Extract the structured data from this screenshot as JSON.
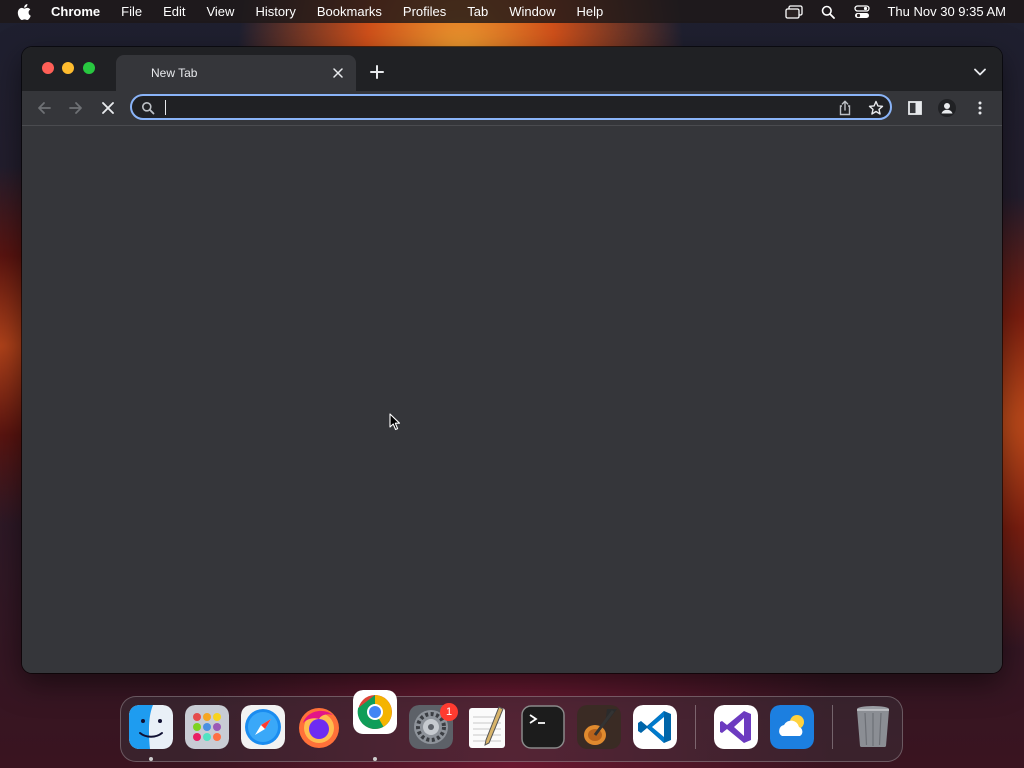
{
  "menubar": {
    "app_name": "Chrome",
    "items": [
      "File",
      "Edit",
      "View",
      "History",
      "Bookmarks",
      "Profiles",
      "Tab",
      "Window",
      "Help"
    ],
    "clock": "Thu Nov 30  9:35 AM",
    "status_icons": [
      "screen-mirroring-icon",
      "spotlight-search-icon",
      "control-center-icon"
    ]
  },
  "browser": {
    "tab": {
      "title": "New Tab"
    },
    "omnibox": {
      "value": "",
      "placeholder": ""
    },
    "accent_color": "#8ab4f8",
    "content_background": "#35363a"
  },
  "dock": {
    "apps": [
      "Finder",
      "Launchpad",
      "Safari",
      "Firefox",
      "Google Chrome",
      "System Settings",
      "TextEdit",
      "Terminal",
      "GarageBand",
      "Visual Studio Code",
      "Visual Studio",
      "Weather",
      "Trash"
    ],
    "settings_badge": "1"
  }
}
